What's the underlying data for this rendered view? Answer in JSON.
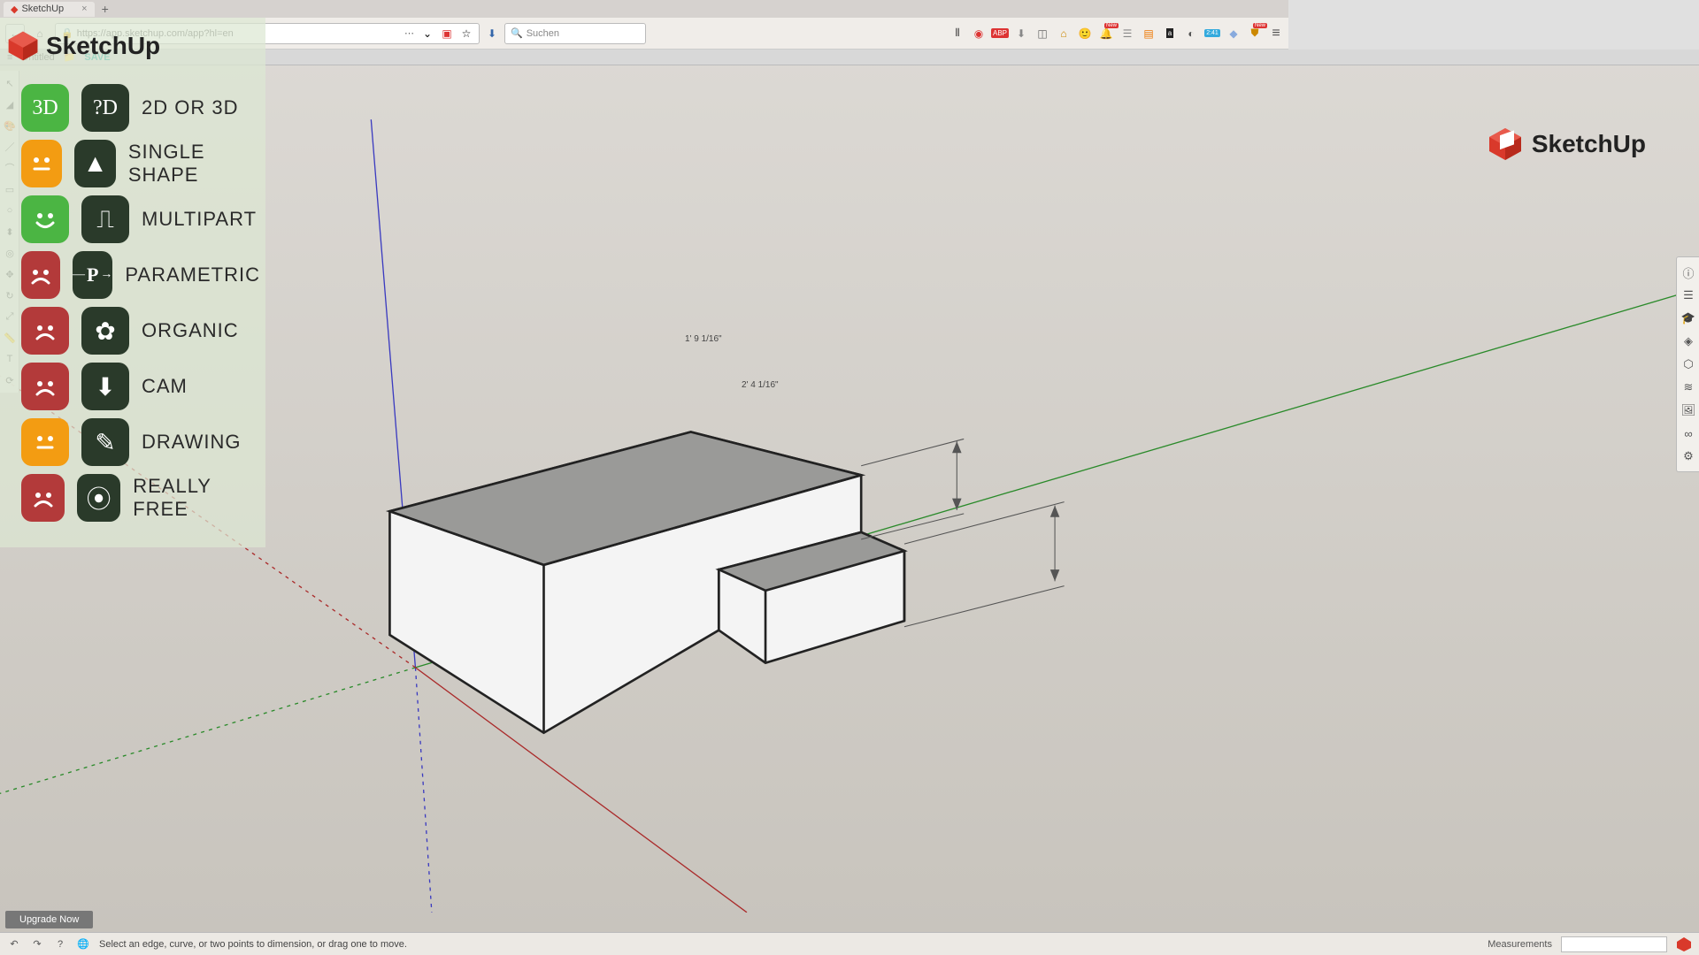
{
  "browser": {
    "tab_title": "SketchUp",
    "url": "https://app.sketchup.com/app?hl=en",
    "search_placeholder": "Suchen",
    "extensions": {
      "badge_new": "New",
      "badge_count": "2:41"
    }
  },
  "app": {
    "menu": "≡",
    "doc_title": "Untitled",
    "save": "SAVE"
  },
  "overlay": {
    "logo_text": "SketchUp",
    "rows": [
      {
        "face": "green",
        "face_text": "3D",
        "cat_text": "?D",
        "label": "2D or 3D"
      },
      {
        "face": "orange",
        "face_glyph": "neutral",
        "cat_glyph": "▲",
        "label": "Single Shape"
      },
      {
        "face": "green",
        "face_glyph": "smile",
        "cat_glyph": "⎍",
        "label": "Multipart"
      },
      {
        "face": "red",
        "face_glyph": "frown",
        "cat_text": "P",
        "label": "Parametric"
      },
      {
        "face": "red",
        "face_glyph": "frown",
        "cat_glyph": "✿",
        "label": "Organic"
      },
      {
        "face": "red",
        "face_glyph": "frown",
        "cat_glyph": "⬇",
        "label": "CAM"
      },
      {
        "face": "orange",
        "face_glyph": "neutral",
        "cat_glyph": "✎",
        "label": "Drawing"
      },
      {
        "face": "red",
        "face_glyph": "frown",
        "cat_glyph": "⦿",
        "label": "Really Free"
      }
    ]
  },
  "watermark": {
    "text": "SketchUp"
  },
  "dimensions": {
    "dim1": "1' 9 1/16\"",
    "dim2": "2' 4 1/16\""
  },
  "upgrade": "Upgrade Now",
  "status": {
    "hint": "Select an edge, curve, or two points to dimension, or drag one to move.",
    "meas_label": "Measurements"
  },
  "colors": {
    "green": "#4bb543",
    "orange": "#f39c12",
    "red": "#b33a3a",
    "cat_bg": "#2a3a2a",
    "accent_red": "#d9392b"
  }
}
